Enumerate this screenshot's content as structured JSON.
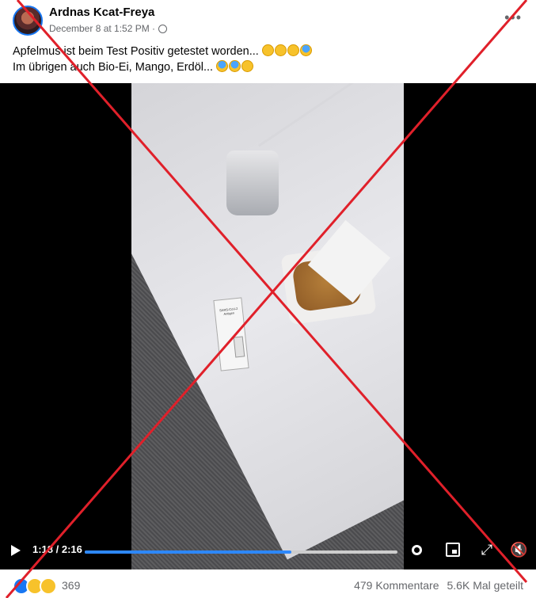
{
  "post": {
    "author": "Ardnas Kcat-Freya",
    "timestamp": "December 8 at 1:52 PM ·",
    "privacy_icon": "globe-icon",
    "text_line1": "Apfelmus ist beim Test Positiv getestet worden...",
    "text_line2": "Im übrigen auch Bio-Ei, Mango, Erdöl..."
  },
  "video": {
    "time": "1:18 / 2:16",
    "progress": 0.66,
    "test_card_text": "SARS-CoV-2 Antigen"
  },
  "footer": {
    "reaction_count": "369",
    "comments": "479 Kommentare",
    "shares": "5.6K Mal geteilt"
  },
  "colors": {
    "accent": "#1877f2",
    "progress": "#2d88ff",
    "cross": "#e0202a"
  }
}
